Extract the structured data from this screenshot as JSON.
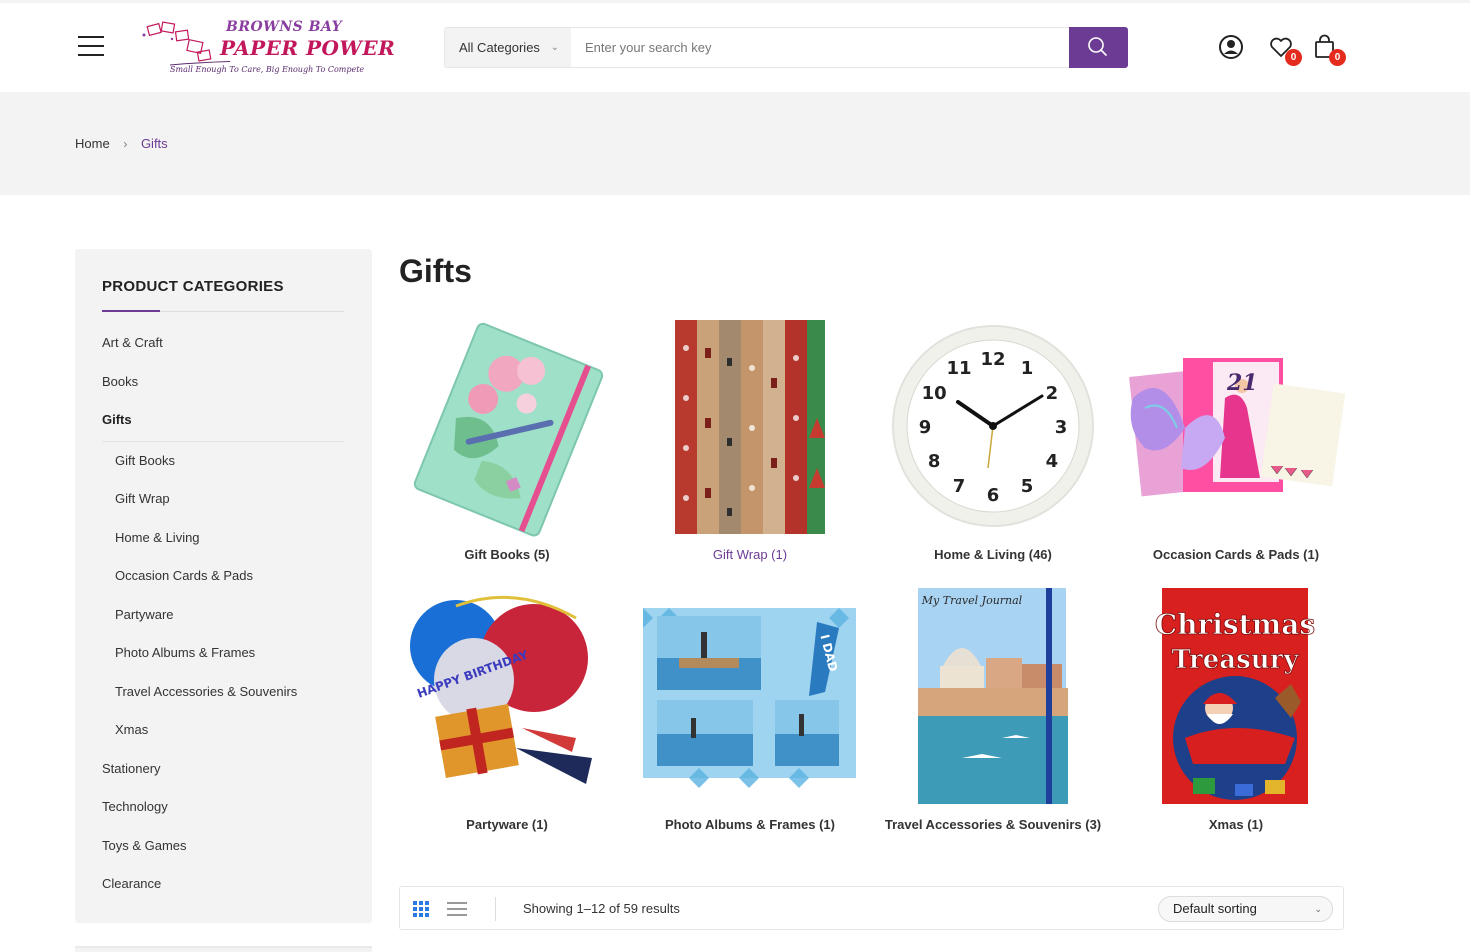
{
  "brand": {
    "line1": "BROWNS BAY",
    "line2": "PAPER POWER",
    "tagline": "Small Enough To Care, Big Enough To Compete"
  },
  "search": {
    "category": "All Categories",
    "placeholder": "Enter your search key"
  },
  "header": {
    "wishlist_count": "0",
    "cart_count": "0"
  },
  "breadcrumb": {
    "home": "Home",
    "current": "Gifts"
  },
  "sidebar": {
    "title": "PRODUCT CATEGORIES",
    "items": [
      {
        "label": "Art & Craft"
      },
      {
        "label": "Books"
      },
      {
        "label": "Gifts"
      },
      {
        "label": "Gift Books"
      },
      {
        "label": "Gift Wrap"
      },
      {
        "label": "Home & Living"
      },
      {
        "label": "Occasion Cards & Pads"
      },
      {
        "label": "Partyware"
      },
      {
        "label": "Photo Albums & Frames"
      },
      {
        "label": "Travel Accessories & Souvenirs"
      },
      {
        "label": "Xmas"
      },
      {
        "label": "Stationery"
      },
      {
        "label": "Technology"
      },
      {
        "label": "Toys & Games"
      },
      {
        "label": "Clearance"
      }
    ]
  },
  "main": {
    "title": "Gifts",
    "tiles": [
      {
        "label": "Gift Books (5)"
      },
      {
        "label": "Gift Wrap (1)"
      },
      {
        "label": "Home & Living (46)"
      },
      {
        "label": "Occasion Cards & Pads (1)"
      },
      {
        "label": "Partyware (1)"
      },
      {
        "label": "Photo Albums & Frames (1)"
      },
      {
        "label": "Travel Accessories & Souvenirs (3)"
      },
      {
        "label": "Xmas (1)"
      }
    ],
    "journal_text": "My Travel Journal",
    "book_title_1": "Christmas",
    "book_title_2": "Treasury",
    "card_number": "21",
    "dad_text": "I DAD",
    "balloon_text": "HAPPY BIRTHDAY",
    "clock_numbers": [
      "12",
      "1",
      "2",
      "3",
      "4",
      "5",
      "6",
      "7",
      "8",
      "9",
      "10",
      "11"
    ]
  },
  "toolbar": {
    "results": "Showing 1–12 of 59 results",
    "sorting": "Default sorting"
  },
  "colors": {
    "accent": "#6c3b94",
    "badge": "#e52a1e",
    "band": "#f3f3f3"
  }
}
